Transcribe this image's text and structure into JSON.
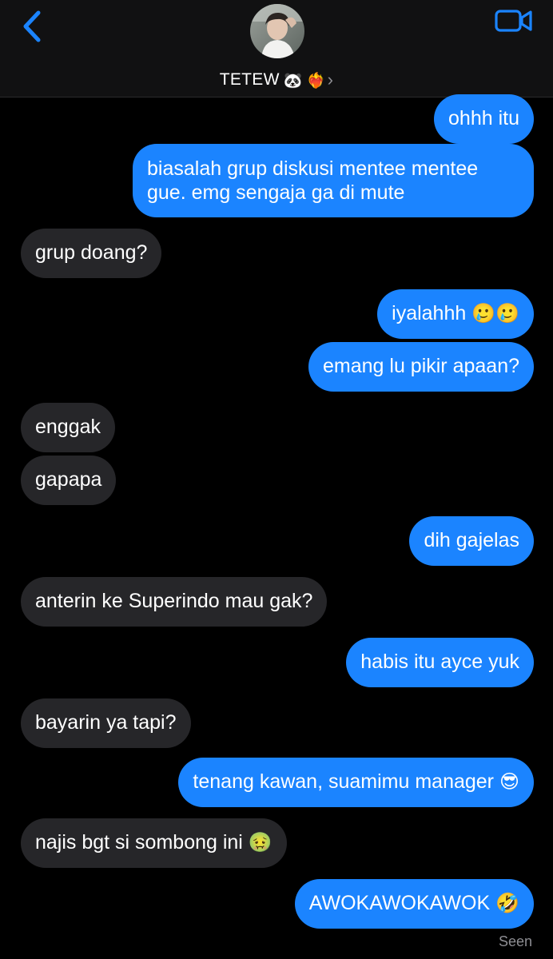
{
  "header": {
    "contact_name": "TETEW",
    "name_emoji_1": "🐼",
    "name_emoji_2": "❤️‍🔥",
    "chevron": "›"
  },
  "colors": {
    "outgoing": "#1b84ff",
    "incoming": "#262629",
    "accent": "#1b84ff"
  },
  "messages": [
    {
      "dir": "out",
      "text": "ohhh itu"
    },
    {
      "dir": "out",
      "text": "biasalah grup diskusi mentee mentee gue. emg sengaja ga di mute"
    },
    {
      "dir": "in",
      "text": "grup doang?"
    },
    {
      "dir": "out",
      "text": "iyalahhh",
      "emoji": "🥲🥲"
    },
    {
      "dir": "out",
      "text": "emang lu pikir apaan?"
    },
    {
      "dir": "in",
      "text": "enggak"
    },
    {
      "dir": "in",
      "text": "gapapa"
    },
    {
      "dir": "out",
      "text": "dih gajelas"
    },
    {
      "dir": "in",
      "text": "anterin ke Superindo mau gak?"
    },
    {
      "dir": "out",
      "text": "habis itu ayce yuk"
    },
    {
      "dir": "in",
      "text": "bayarin ya tapi?"
    },
    {
      "dir": "out",
      "text": "tenang kawan, suamimu manager",
      "emoji": "😎"
    },
    {
      "dir": "in",
      "text": "najis bgt si sombong ini",
      "emoji": "🤢"
    },
    {
      "dir": "out",
      "text": "AWOKAWOKAWOK",
      "emoji": "🤣"
    }
  ],
  "status": {
    "seen": "Seen"
  }
}
